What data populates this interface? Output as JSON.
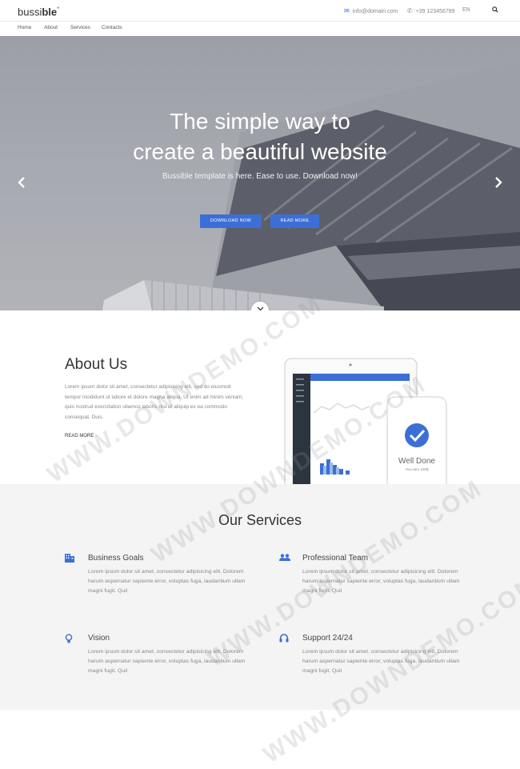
{
  "header": {
    "logo_prefix": "bussi",
    "logo_bold": "ble",
    "logo_mark": "*",
    "email": "info@domain.com",
    "phone": "+39 123456789",
    "lang": "EN"
  },
  "nav": {
    "items": [
      "Home",
      "About",
      "Services",
      "Contacts"
    ]
  },
  "hero": {
    "title_line1": "The simple way to",
    "title_line2": "create a beautiful website",
    "subtitle": "Bussible template is here. Ease to use. Download now!",
    "btn_download": "DOWNLOAD NOW",
    "btn_read": "READ MORE"
  },
  "about": {
    "title": "About Us",
    "text": "Lorem ipsum dolor sit amet, consectetur adipisicing elit, sed do eiusmod tempor incididunt ut labore et dolore magna aliqua. Ut enim ad minim veniam, quis nostrud exercitation ullamco laboris nisi ut aliquip ex ea commodo consequat. Duis.",
    "more": "READ MORE",
    "phone_caption": "Well Done",
    "phone_sub": "You earn 150$"
  },
  "services": {
    "title": "Our Services",
    "items": [
      {
        "title": "Business Goals",
        "text": "Lorem ipsum dolor sit amet, consectetur adipisicing elit. Dolorem harum aspernatur sapiente error, voluptas fuga, laudantium ullam magni fugit. Quil"
      },
      {
        "title": "Professional Team",
        "text": "Lorem ipsum dolor sit amet, consectetur adipisicing elit. Dolorem harum aspernatur sapiente error, voluptas fuga, laudantium ullam magni fugit. Quil"
      },
      {
        "title": "Vision",
        "text": "Lorem ipsum dolor sit amet, consectetur adipisicing elit. Dolorem harum aspernatur sapiente error, voluptas fuga, laudantium ullam magni fugit. Quil"
      },
      {
        "title": "Support 24/24",
        "text": "Lorem ipsum dolor sit amet, consectetur adipisicing elit. Dolorem harum aspernatur sapiente error, voluptas fuga, laudantium ullam magni fugit. Quil"
      }
    ]
  },
  "watermark": "WWW.DOWNDEMO.COM",
  "colors": {
    "accent": "#3b6fd6"
  }
}
